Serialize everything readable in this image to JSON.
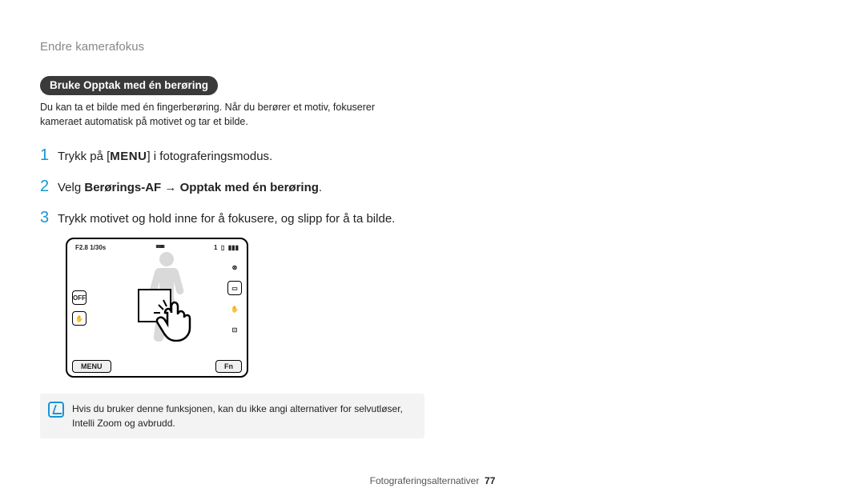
{
  "header": {
    "title": "Endre kamerafokus"
  },
  "section": {
    "pill": "Bruke Opptak med én berøring",
    "intro": "Du kan ta et bilde med én fingerberøring. Når du berører et motiv, fokuserer kameraet automatisk på motivet og tar et bilde."
  },
  "steps": {
    "s1": {
      "num": "1",
      "pre": "Trykk på [",
      "menu": "MENU",
      "post": "] i fotograferingsmodus."
    },
    "s2": {
      "num": "2",
      "pre": "Velg ",
      "b1": "Berørings-AF",
      "arrow": " → ",
      "b2": "Opptak med én berøring",
      "post": "."
    },
    "s3": {
      "num": "3",
      "text": "Trykk motivet og hold inne for å fokusere, og slipp for å ta bilde."
    }
  },
  "illus": {
    "exposure": "F2.8 1/30s",
    "ticks": "ııııııııııı",
    "count": "1",
    "batt": "▮▮▮",
    "menu_btn": "MENU",
    "fn_btn": "Fn",
    "left_icons": [
      "OFF",
      "✋"
    ],
    "right_icons": [
      "⊛",
      "▭",
      "✋",
      "⊡"
    ]
  },
  "note": "Hvis du bruker denne funksjonen, kan du ikke angi alternativer for selvutløser, Intelli Zoom og avbrudd.",
  "footer": {
    "section": "Fotograferingsalternativer",
    "page": "77"
  }
}
